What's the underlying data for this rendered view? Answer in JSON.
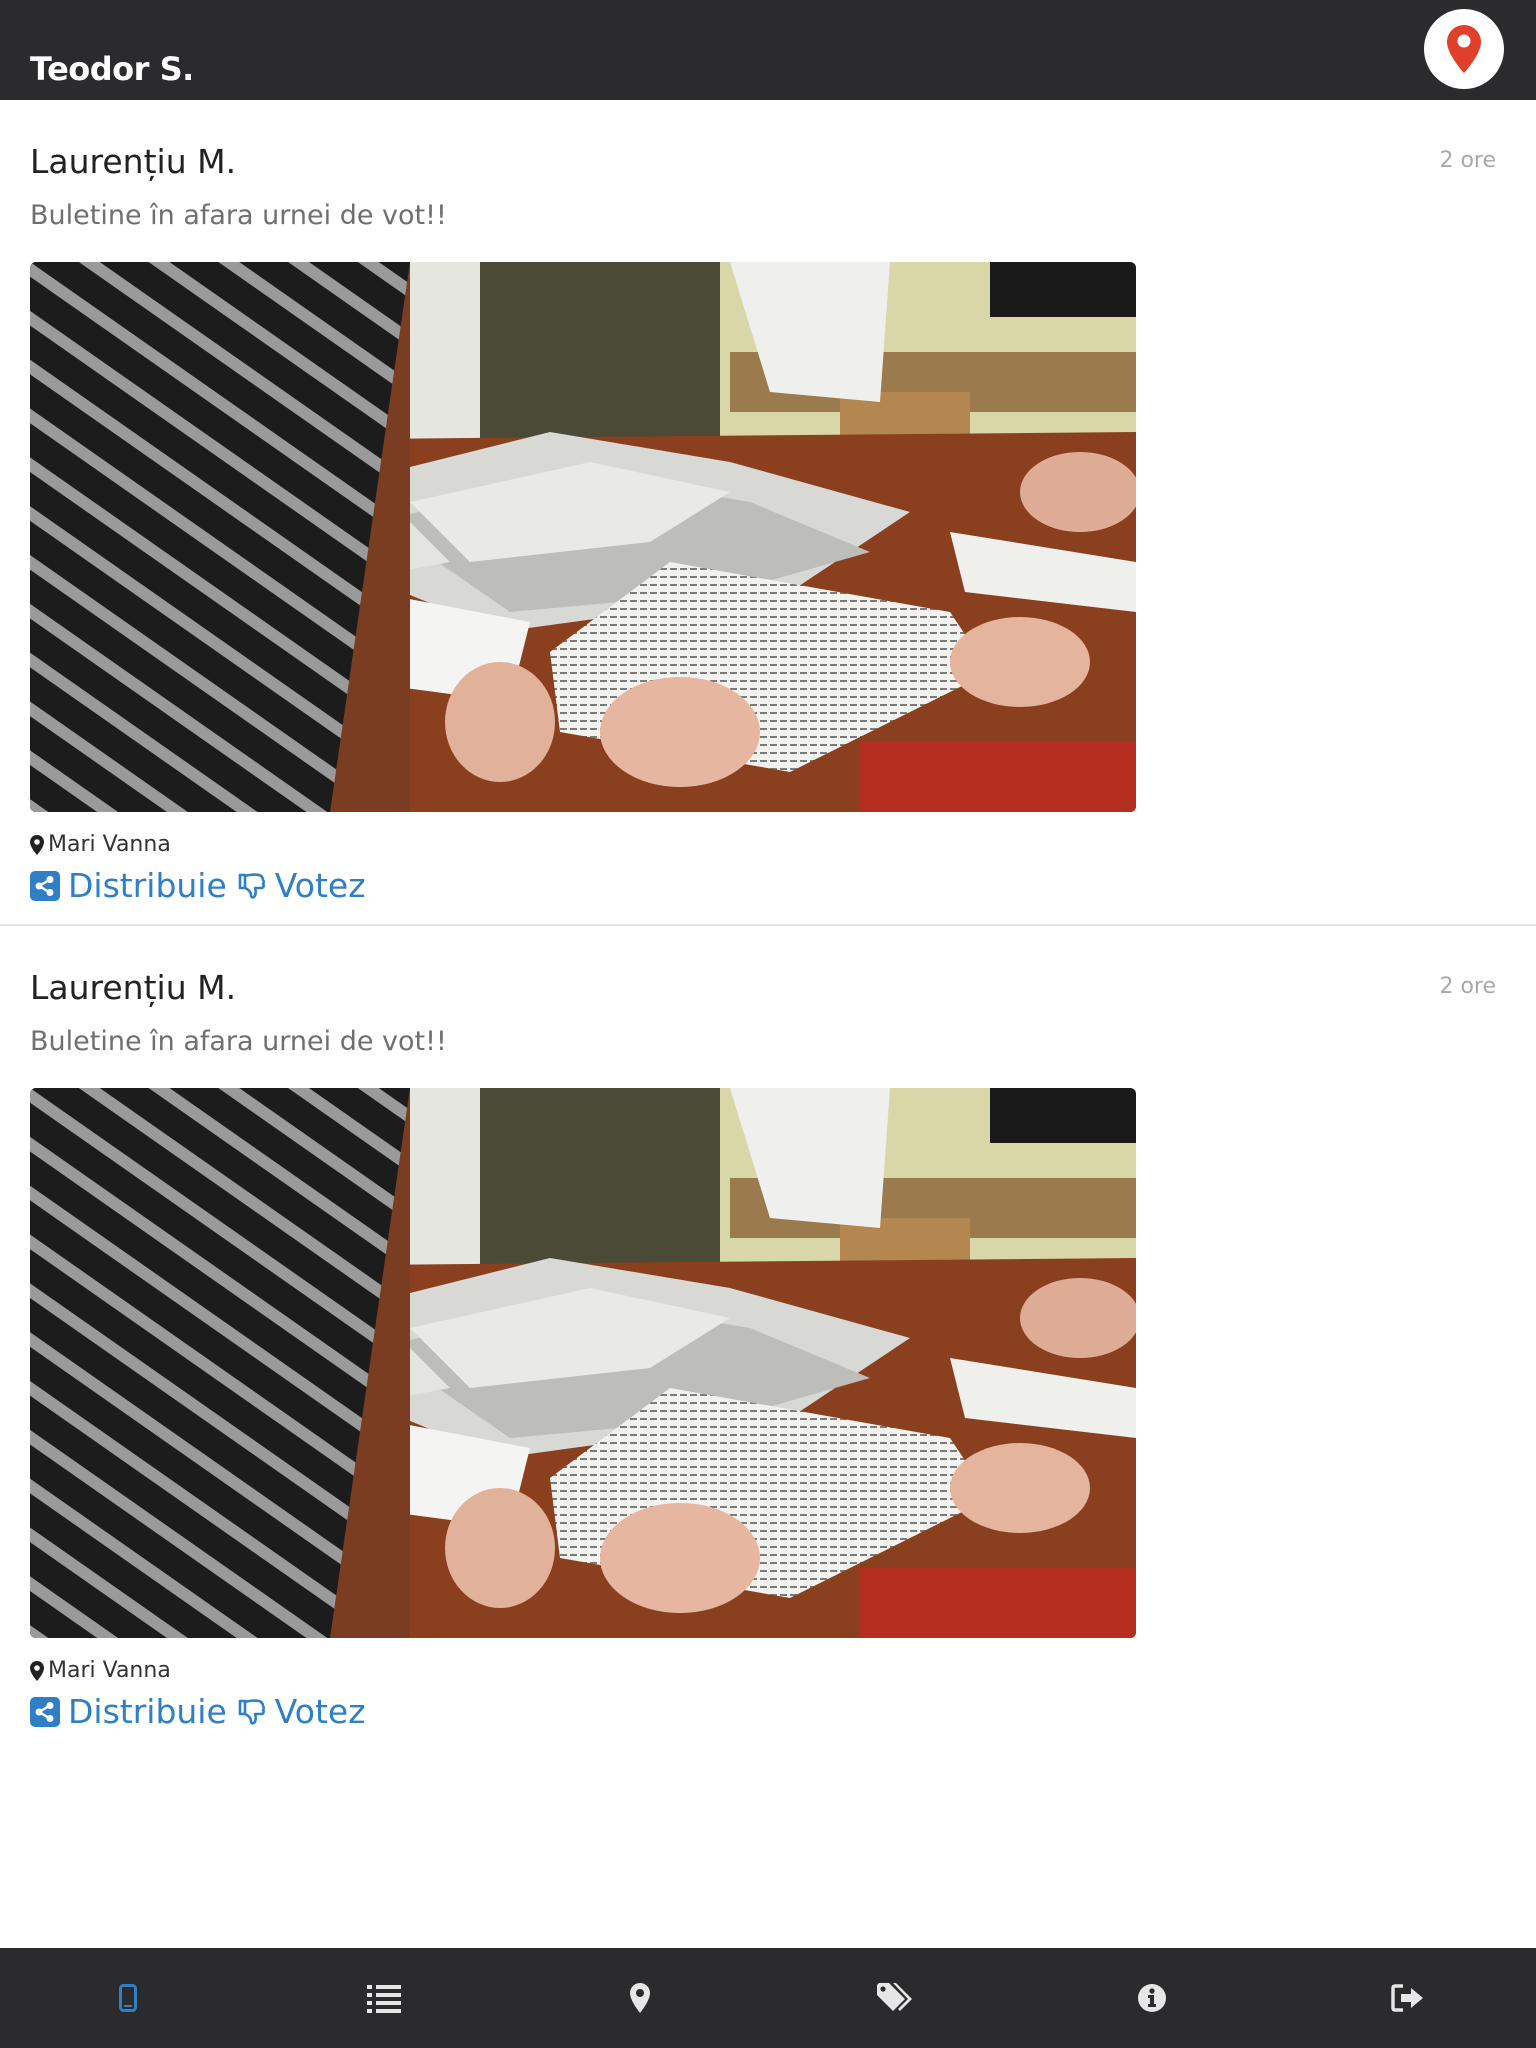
{
  "header": {
    "title": "Teodor S.",
    "map_icon": "map-marker-icon",
    "accent": "#e0402b"
  },
  "posts": [
    {
      "author": "Laurențiu M.",
      "time": "2 ore",
      "text": "Buletine în afara urnei de vot!!",
      "location": "Mari Vanna",
      "share_label": "Distribuie",
      "vote_label": "Votez"
    },
    {
      "author": "Laurențiu M.",
      "time": "2 ore",
      "text": "Buletine în afara urnei de vot!!",
      "location": "Mari Vanna",
      "share_label": "Distribuie",
      "vote_label": "Votez"
    }
  ],
  "bottom_nav": {
    "items": [
      "mobile-icon",
      "list-icon",
      "map-marker-icon",
      "tags-icon",
      "info-icon",
      "sign-out-icon"
    ],
    "active_index": 0,
    "active_color": "#2f7fc6",
    "color": "#e6e6e6"
  },
  "colors": {
    "link": "#2f7fc6",
    "bar": "#2b2b2d"
  }
}
